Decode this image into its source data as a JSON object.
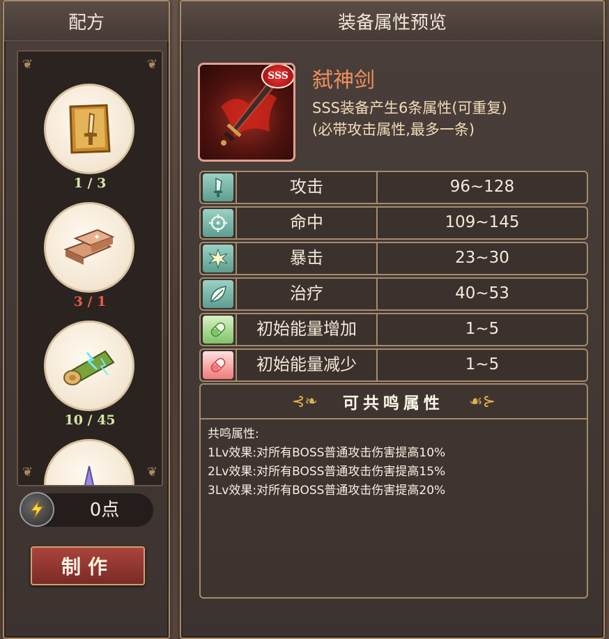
{
  "left_panel": {
    "title": "配方",
    "recipes": [
      {
        "icon": "sword-scroll-icon",
        "count": "1 / 3",
        "count_color": "#d7e6a8"
      },
      {
        "icon": "ingot-icon",
        "count": "3 / 1",
        "count_color": "#ee5a4a"
      },
      {
        "icon": "lightning-log-icon",
        "count": "10 / 45",
        "count_color": "#d7e6a8"
      },
      {
        "icon": "crystal-icon",
        "count": "",
        "count_color": "#d7e6a8"
      }
    ],
    "points_label": "0点",
    "craft_label": "制作"
  },
  "right_panel": {
    "title": "装备属性预览",
    "item": {
      "name": "弑神剑",
      "rarity": "SSS",
      "desc_line1": "SSS装备产生6条属性(可重复)",
      "desc_line2": "(必带攻击属性,最多一条)"
    },
    "stats": [
      {
        "icon": "sword-icon",
        "name": "攻击",
        "value": "96~128"
      },
      {
        "icon": "crosshair-icon",
        "name": "命中",
        "value": "109~145"
      },
      {
        "icon": "burst-icon",
        "name": "暴击",
        "value": "23~30"
      },
      {
        "icon": "leaf-icon",
        "name": "治疗",
        "value": "40~53"
      },
      {
        "icon": "capsule-green-icon",
        "name": "初始能量增加",
        "value": "1~5"
      },
      {
        "icon": "capsule-red-icon",
        "name": "初始能量减少",
        "value": "1~5"
      }
    ],
    "resonance": {
      "title": "可共鸣属性",
      "heading": "共鸣属性:",
      "lines": [
        "1Lv效果:对所有BOSS普通攻击伤害提高10%",
        "2Lv效果:对所有BOSS普通攻击伤害提高15%",
        "3Lv效果:对所有BOSS普通攻击伤害提高20%"
      ]
    }
  },
  "colors": {
    "panel_border": "#a88a6a",
    "item_name": "#f0905e",
    "craft_button": "#8e3530"
  }
}
